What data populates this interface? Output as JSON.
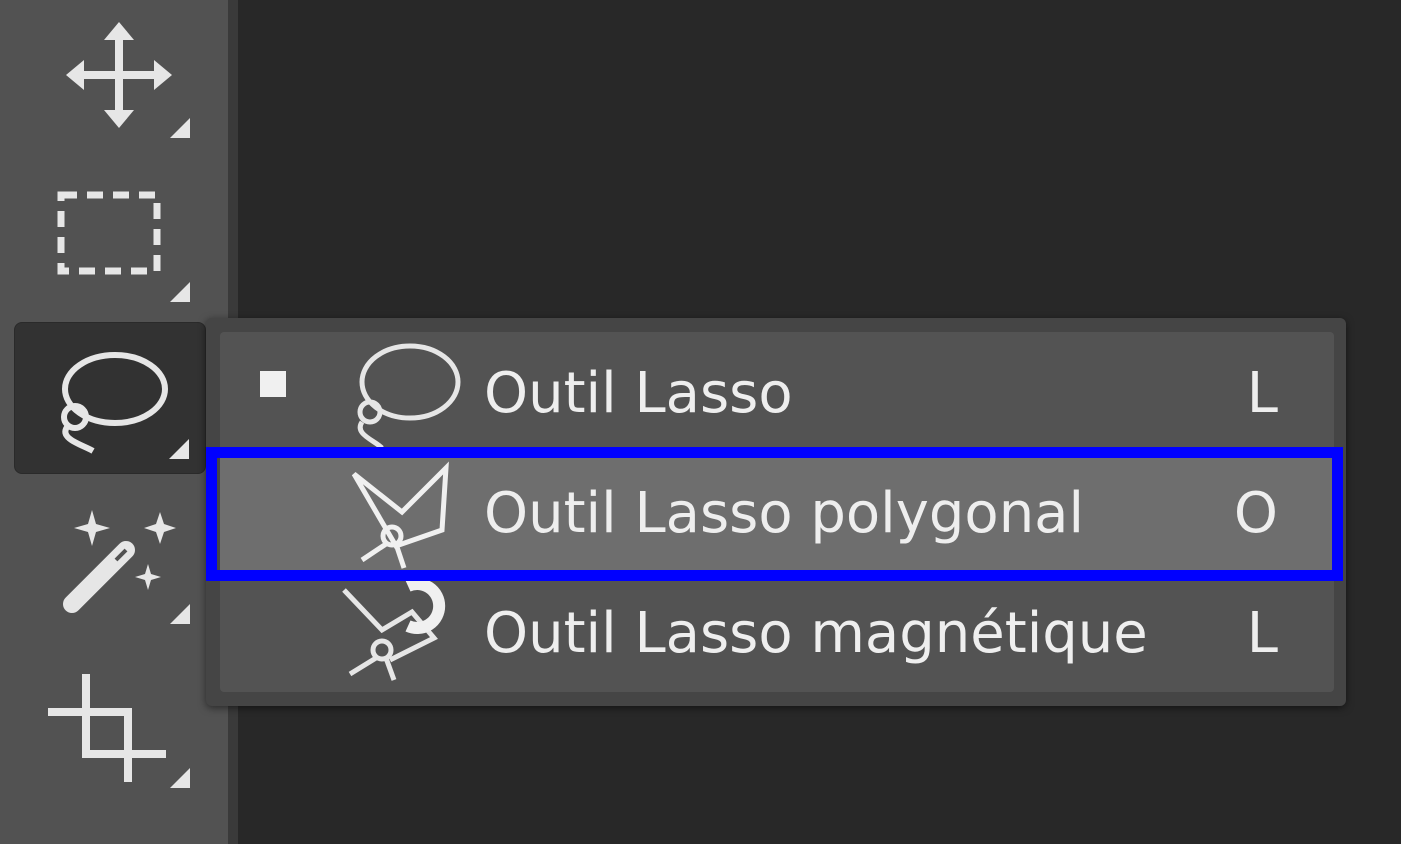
{
  "toolbar": {
    "tools": [
      {
        "name": "move-tool",
        "icon": "move-arrows-icon"
      },
      {
        "name": "rectangular-marquee-tool",
        "icon": "dashed-rectangle-icon"
      },
      {
        "name": "lasso-tool",
        "icon": "lasso-icon",
        "active": true
      },
      {
        "name": "magic-wand-tool",
        "icon": "magic-wand-icon"
      },
      {
        "name": "crop-tool",
        "icon": "crop-icon"
      }
    ]
  },
  "flyout": {
    "items": [
      {
        "label": "Outil Lasso",
        "shortcut": "L",
        "icon": "lasso-icon",
        "selected": true
      },
      {
        "label": "Outil Lasso polygonal",
        "shortcut": "O",
        "icon": "polygonal-lasso-icon",
        "hovered": true
      },
      {
        "label": "Outil Lasso magnétique",
        "shortcut": "L",
        "icon": "magnetic-lasso-icon"
      }
    ]
  },
  "colors": {
    "toolbar_bg": "#525252",
    "canvas_bg": "#282828",
    "flyout_bg": "#535353",
    "hover_bg": "#6e6e6e",
    "highlight_border": "#0000ff",
    "text": "#eeeeee"
  }
}
